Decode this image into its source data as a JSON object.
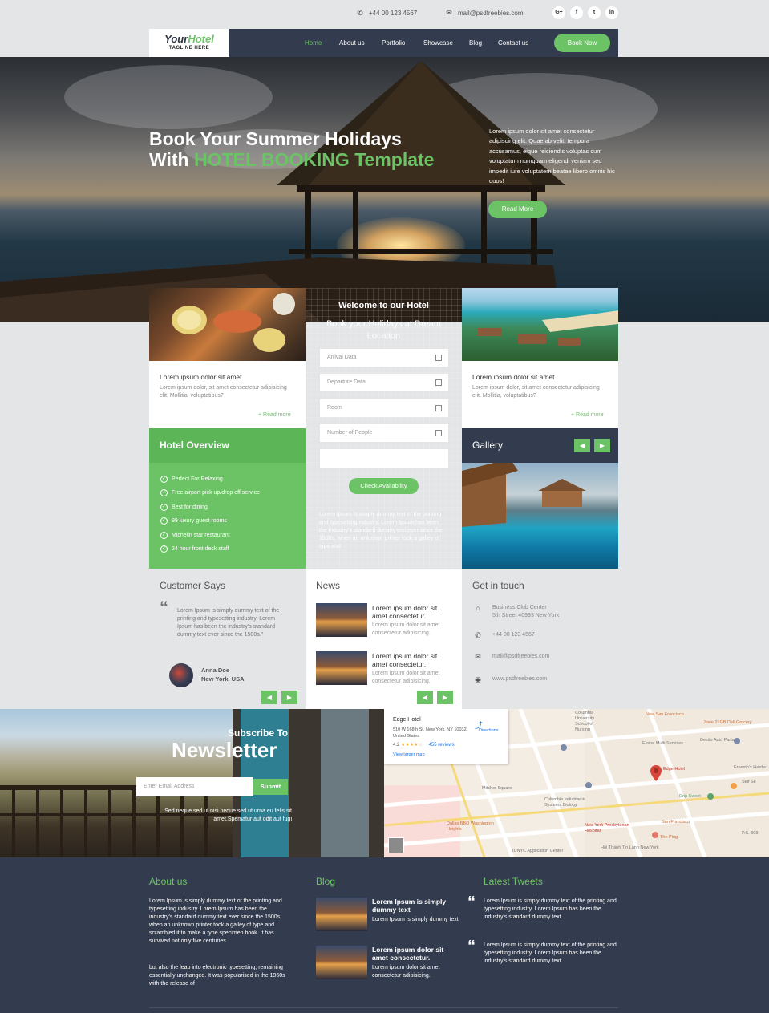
{
  "topbar": {
    "phone": "+44 00 123 4567",
    "email": "mail@psdfreebies.com",
    "social": [
      "G+",
      "f",
      "t",
      "in"
    ]
  },
  "logo": {
    "part1": "Your",
    "part2": "Hotel",
    "tagline": "TAGLINE HERE"
  },
  "nav": {
    "items": [
      "Home",
      "About us",
      "Portfolio",
      "Showcase",
      "Blog",
      "Contact us"
    ],
    "cta": "Book Now"
  },
  "hero": {
    "title_line1": "Book Your Summer Holidays",
    "title_with": "With",
    "title_brand": "HOTEL BOOKING",
    "title_end": "Template",
    "text": "Lorem ipsum dolor sit amet consectetur adipiscing elit. Quae ab velit, tempora accusamus, eique reiciendis voluptas cum voluptatum numquam eligendi veniam sed impedit iure voluptatem beatae libero omnis hic quos!",
    "cta": "Read More"
  },
  "cards": [
    {
      "title": "Lorem ipsum dolor sit amet",
      "text": "Lorem ipsum dolor, sit amet consectetur adipisicing elit. Mollitia, voluptatibus?",
      "more": "+ Read more"
    },
    {
      "title": "Lorem ipsum dolor sit amet",
      "text": "Lorem ipsum dolor, sit amet consectetur adipisicing elit. Mollitia, voluptatibus?",
      "more": "+ Read more"
    }
  ],
  "booking": {
    "heading": "Welcome to our Hotel",
    "subheading": "Book your Holidays at Dream Location",
    "fields": [
      "Arrival Data",
      "Departure Data",
      "Room",
      "Number of People"
    ],
    "button": "Check Availability",
    "text": "Lorem Ipsum is simply dummy text of the printing and typesetting industry. Lorem Ipsum has been the industry's standard dummy text ever since the 1500s, when an unknown printer took a galley of type and"
  },
  "overview": {
    "title": "Hotel Overview",
    "items": [
      "Perfect For Relaxing",
      "Free airport pick up/drop off service",
      "Best for dining",
      "99 luxury guest rooms",
      "Michelin star restaurant",
      "24 hour front desk staff"
    ]
  },
  "gallery": {
    "title": "Gallery"
  },
  "customer": {
    "title": "Customer Says",
    "quote": "Lorem Ipsum is simply dummy text of the printing and typesetting industry. Lorem Ipsum has been the industry's standard dummy text ever since the 1500s.\"",
    "name": "Anna Doe",
    "location": "New York, USA"
  },
  "news": {
    "title": "News",
    "items": [
      {
        "title": "Lorem ipsum dolor sit amet consectetur.",
        "text": "Lorem ipsum dolor sit amet consectetur adipisicing."
      },
      {
        "title": "Lorem ipsum dolor sit amet consectetur.",
        "text": "Lorem ipsum dolor sit amet consectetur adipisicing."
      }
    ]
  },
  "contact": {
    "title": "Get in touch",
    "address_line1": "Business Club Center",
    "address_line2": "5th Street 40993 New York",
    "phone": "+44 00 123 4567",
    "email": "mail@psdfreebies.com",
    "web": "www.psdfreebies.com"
  },
  "newsletter": {
    "pre": "Subscribe To",
    "title": "Newsletter",
    "placeholder": "Enter Email Address",
    "button": "Submit",
    "text": "Sed neque sed ut nisi neque sed ut urna eu felis sit amet.Spematur aut odit aut fugi"
  },
  "map": {
    "place": "Edge Hotel",
    "address1": "510 W 168th St, New York, NY 10032,",
    "address2": "United States",
    "rating": "4.2",
    "stars": "★★★★☆",
    "reviews": "455 reviews",
    "larger": "View larger map",
    "directions": "Directions",
    "labels": [
      "Columbia University School of Nursing",
      "New San Francisco",
      "Josie 21GB Deli Grocery",
      "Elaine Multi Services",
      "Desito Auto Parts",
      "Edge Hotel",
      "Columbia Initiative in Systems Biology",
      "Drip Sweet",
      "New York Presbyterian Hospital",
      "San Francisco",
      "The Plug",
      "Dallas BBQ Washington Heights",
      "Mitcher Square",
      "Hội Thánh Tin Lành New York",
      "IDNYC Application Center",
      "Ernesto's Hardw",
      "Self Se",
      "P.S. 808"
    ]
  },
  "footer": {
    "about_title": "About us",
    "about_text1": "Lorem Ipsum is simply dummy text of the printing and typesetting industry. Lorem Ipsum has been the industry's standard dummy text ever since the 1500s, when an unknown printer took a galley of type and scrambled it to make a type specimen book. It has survived not only five centuries",
    "about_text2": "but also the leap into electronic typesetting, remaining essentially unchanged. It was popularised in the 1960s with the release of",
    "blog_title": "Blog",
    "blog": [
      {
        "title": "Lorem Ipsum is simply dummy text",
        "text": "Lorem Ipsum is simply dummy text"
      },
      {
        "title": "Lorem ipsum dolor sit amet consectetur.",
        "text": "Lorem ipsum dolor sit amet consectetur adipisicing."
      }
    ],
    "tweets_title": "Latest Tweets",
    "tweets": [
      "Lorem Ipsum is simply dummy text of the printing and typesetting industry. Lorem Ipsum has been the industry's standard dummy text.",
      "Lorem Ipsum is simply dummy text of the printing and typesetting industry. Lorem Ipsum has been the industry's standard dummy text."
    ]
  },
  "colors": {
    "accent": "#6cc365",
    "dark": "#333c4e",
    "booking_blue": "#1461c4"
  }
}
